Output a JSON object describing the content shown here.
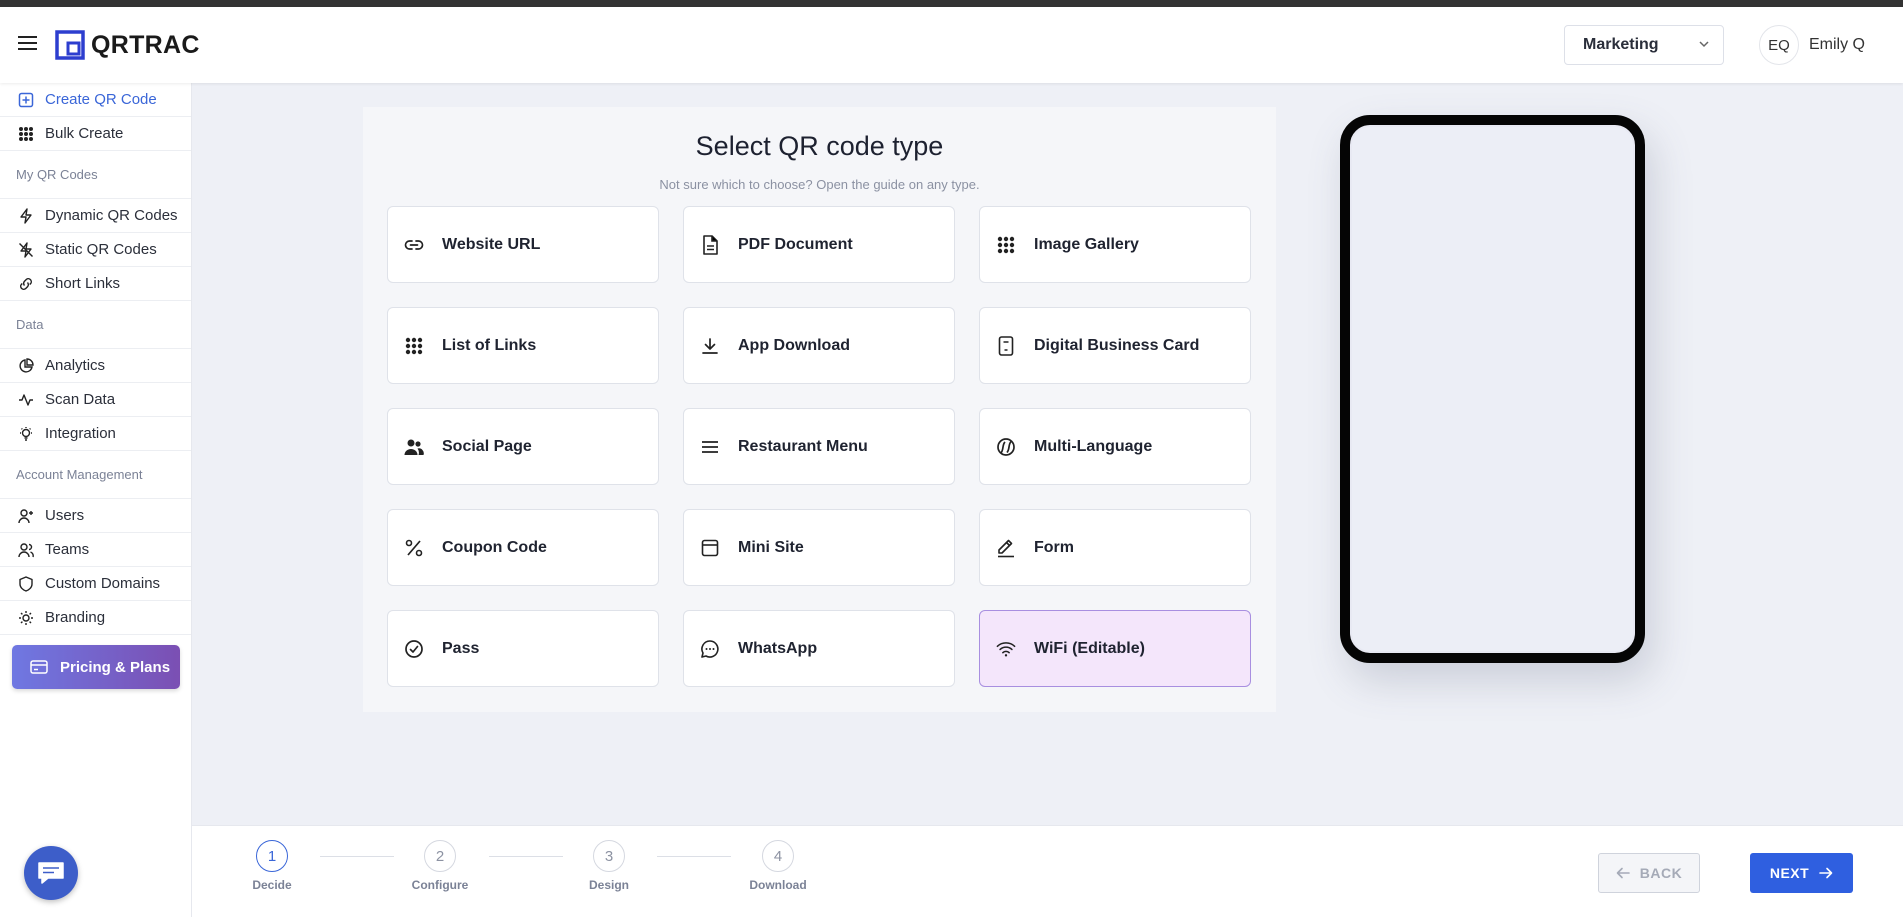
{
  "header": {
    "logo_text": "QRTRAC",
    "team_select_value": "Marketing",
    "user_initials": "EQ",
    "user_name": "Emily Q"
  },
  "sidebar": {
    "items_top": [
      {
        "label": "Create QR Code",
        "icon": "plus-square-icon"
      },
      {
        "label": "Bulk Create",
        "icon": "grid-dots-icon"
      }
    ],
    "section_my_qr": "My QR Codes",
    "items_my_qr": [
      {
        "label": "Dynamic QR Codes",
        "icon": "lightning-icon"
      },
      {
        "label": "Static QR Codes",
        "icon": "lightning-off-icon"
      },
      {
        "label": "Short Links",
        "icon": "link-icon"
      }
    ],
    "section_data": "Data",
    "items_data": [
      {
        "label": "Analytics",
        "icon": "pie-chart-icon"
      },
      {
        "label": "Scan Data",
        "icon": "activity-icon"
      },
      {
        "label": "Integration",
        "icon": "bulb-icon"
      }
    ],
    "section_account": "Account Management",
    "items_account": [
      {
        "label": "Users",
        "icon": "user-plus-icon"
      },
      {
        "label": "Teams",
        "icon": "users-icon"
      },
      {
        "label": "Custom Domains",
        "icon": "shield-icon"
      },
      {
        "label": "Branding",
        "icon": "sun-icon"
      }
    ],
    "pricing_label": "Pricing & Plans"
  },
  "main": {
    "title": "Select QR code type",
    "subtitle": "Not sure which to choose? Open the guide on any type.",
    "types": [
      {
        "label": "Website URL",
        "icon": "link-icon"
      },
      {
        "label": "PDF Document",
        "icon": "file-icon"
      },
      {
        "label": "Image Gallery",
        "icon": "grid-dots-icon"
      },
      {
        "label": "List of Links",
        "icon": "grid-dots-icon"
      },
      {
        "label": "App Download",
        "icon": "download-icon"
      },
      {
        "label": "Digital Business Card",
        "icon": "contact-card-icon"
      },
      {
        "label": "Social Page",
        "icon": "people-icon"
      },
      {
        "label": "Restaurant Menu",
        "icon": "menu-lines-icon"
      },
      {
        "label": "Multi-Language",
        "icon": "globe-icon"
      },
      {
        "label": "Coupon Code",
        "icon": "percent-icon"
      },
      {
        "label": "Mini Site",
        "icon": "browser-icon"
      },
      {
        "label": "Form",
        "icon": "pencil-icon"
      },
      {
        "label": "Pass",
        "icon": "check-circle-icon"
      },
      {
        "label": "WhatsApp",
        "icon": "chat-bubble-icon"
      },
      {
        "label": "WiFi (Editable)",
        "icon": "wifi-icon"
      }
    ],
    "selected_type": "WiFi (Editable)"
  },
  "footer": {
    "steps": [
      {
        "number": "1",
        "label": "Decide"
      },
      {
        "number": "2",
        "label": "Configure"
      },
      {
        "number": "3",
        "label": "Design"
      },
      {
        "number": "4",
        "label": "Download"
      }
    ],
    "active_step": "1",
    "back_label": "BACK",
    "next_label": "NEXT"
  },
  "colors": {
    "accent": "#2f5fe0",
    "active_nav": "#3a66d8",
    "selected_card_bg": "#f4e6fb",
    "pricing_gradient_start": "#6f78e2",
    "pricing_gradient_end": "#7b4fb3"
  }
}
